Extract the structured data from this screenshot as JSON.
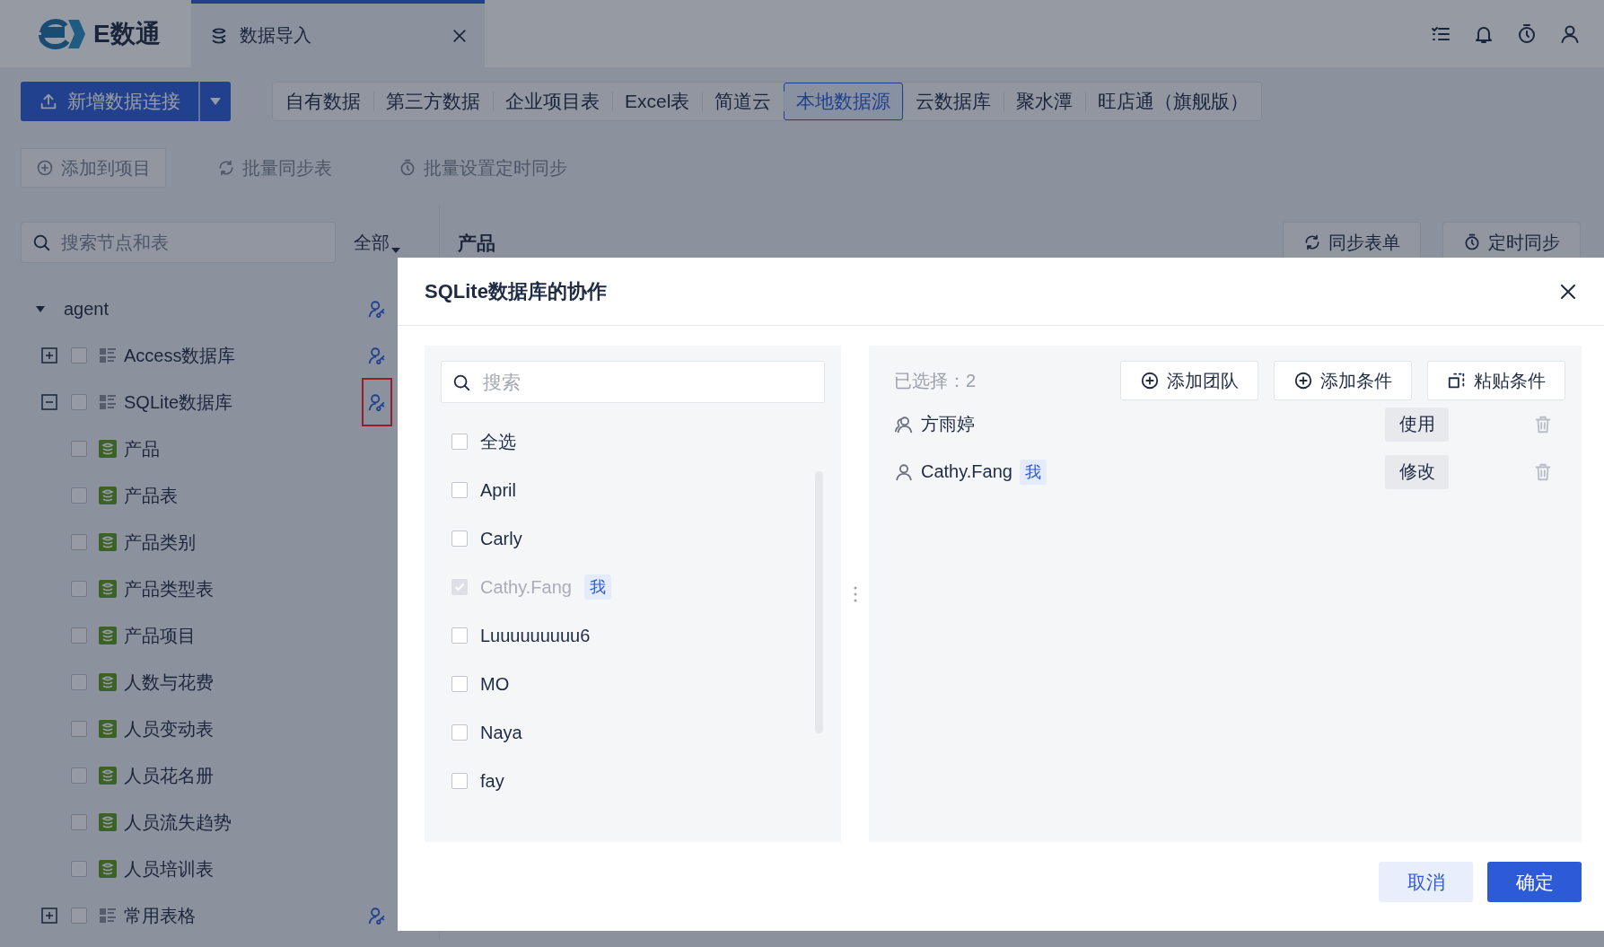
{
  "header": {
    "logo_text": "E数通",
    "tab": {
      "label": "数据导入",
      "selected": true
    }
  },
  "toolbar": {
    "primary_button": "新增数据连接",
    "source_tabs": [
      {
        "label": "自有数据",
        "selected": false
      },
      {
        "label": "第三方数据",
        "selected": false
      },
      {
        "label": "企业项目表",
        "selected": false
      },
      {
        "label": "Excel表",
        "selected": false
      },
      {
        "label": "简道云",
        "selected": false
      },
      {
        "label": "本地数据源",
        "selected": true
      },
      {
        "label": "云数据库",
        "selected": false
      },
      {
        "label": "聚水潭",
        "selected": false
      },
      {
        "label": "旺店通（旗舰版）",
        "selected": false
      }
    ]
  },
  "actions": [
    {
      "label": "添加到项目",
      "kind": "add",
      "disabled": true
    },
    {
      "label": "批量同步表",
      "kind": "sync",
      "disabled": true
    },
    {
      "label": "批量设置定时同步",
      "kind": "timer",
      "disabled": true
    }
  ],
  "left_panel": {
    "search": {
      "placeholder": "搜索节点和表"
    },
    "filter": "全部",
    "tree": [
      {
        "label": "agent",
        "expanded": true,
        "children": [
          {
            "label": "Access数据库",
            "expanded": false,
            "checked": false,
            "highlighted": false
          },
          {
            "label": "SQLite数据库",
            "expanded": true,
            "checked": false,
            "highlighted": true,
            "children": [
              {
                "label": "产品",
                "checked": false
              },
              {
                "label": "产品表",
                "checked": false
              },
              {
                "label": "产品类别",
                "checked": false
              },
              {
                "label": "产品类型表",
                "checked": false
              },
              {
                "label": "产品项目",
                "checked": false
              },
              {
                "label": "人数与花费",
                "checked": false
              },
              {
                "label": "人员变动表",
                "checked": false
              },
              {
                "label": "人员花名册",
                "checked": false
              },
              {
                "label": "人员流失趋势",
                "checked": false
              },
              {
                "label": "人员培训表",
                "checked": false
              }
            ]
          },
          {
            "label": "常用表格",
            "expanded": false,
            "checked": false,
            "highlighted": false
          }
        ]
      }
    ]
  },
  "content_header": {
    "title": "产品",
    "buttons": [
      {
        "label": "同步表单",
        "kind": "sync"
      },
      {
        "label": "定时同步",
        "kind": "timer"
      }
    ]
  },
  "dialog": {
    "title": "SQLite数据库的协作",
    "search": {
      "placeholder": "搜索"
    },
    "members": [
      {
        "name": "全选",
        "checked": false,
        "disabled": false
      },
      {
        "name": "April",
        "checked": false,
        "disabled": false
      },
      {
        "name": "Carly",
        "checked": false,
        "disabled": false
      },
      {
        "name": "Cathy.Fang",
        "checked": true,
        "disabled": true,
        "tag": "我"
      },
      {
        "name": "Luuuuuuuuu6",
        "checked": false,
        "disabled": false
      },
      {
        "name": "MO",
        "checked": false,
        "disabled": false
      },
      {
        "name": "Naya",
        "checked": false,
        "disabled": false
      },
      {
        "name": "fay",
        "checked": false,
        "disabled": false
      }
    ],
    "selected_count": "已选择：2",
    "buttons": [
      {
        "label": "添加团队",
        "kind": "add"
      },
      {
        "label": "添加条件",
        "kind": "add"
      },
      {
        "label": "粘贴条件",
        "kind": "paste"
      }
    ],
    "collaborators": [
      {
        "kind": "team",
        "name": "方雨婷",
        "permission": "使用"
      },
      {
        "kind": "user",
        "name": "Cathy.Fang",
        "tag": "我",
        "permission": "修改"
      }
    ],
    "footer": [
      {
        "label": "取消",
        "kind": "secondary"
      },
      {
        "label": "确定",
        "kind": "primary"
      }
    ]
  }
}
